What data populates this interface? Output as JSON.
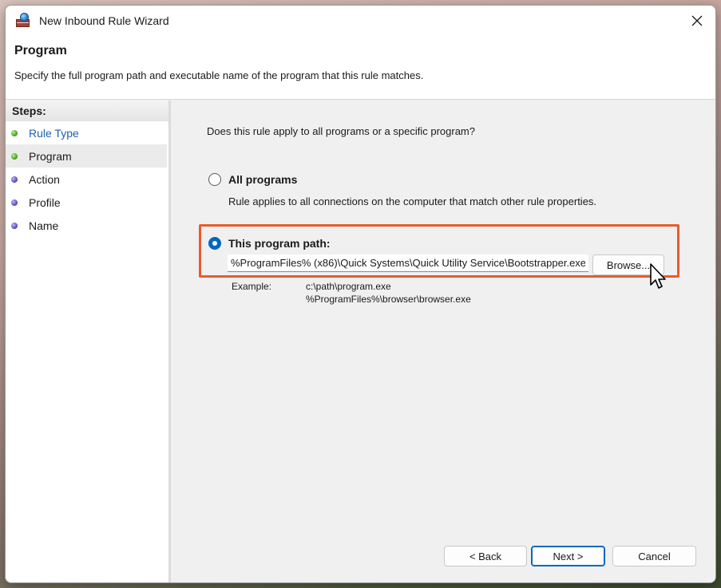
{
  "window": {
    "title": "New Inbound Rule Wizard",
    "close_icon": "close-icon",
    "app_icon": "firewall-icon"
  },
  "header": {
    "title": "Program",
    "subtitle": "Specify the full program path and executable name of the program that this rule matches."
  },
  "steps": {
    "title": "Steps:",
    "items": [
      {
        "label": "Rule Type",
        "state": "completed"
      },
      {
        "label": "Program",
        "state": "current"
      },
      {
        "label": "Action",
        "state": "pending"
      },
      {
        "label": "Profile",
        "state": "pending"
      },
      {
        "label": "Name",
        "state": "pending"
      }
    ]
  },
  "main": {
    "question": "Does this rule apply to all programs or a specific program?",
    "all_programs": {
      "label": "All programs",
      "description": "Rule applies to all connections on the computer that match other rule properties.",
      "checked": false
    },
    "program_path": {
      "label": "This program path:",
      "checked": true,
      "value": "%ProgramFiles% (x86)\\Quick Systems\\Quick Utility Service\\Bootstrapper.exe",
      "browse_label": "Browse..."
    },
    "example": {
      "label": "Example:",
      "line1": "c:\\path\\program.exe",
      "line2": "%ProgramFiles%\\browser\\browser.exe"
    }
  },
  "footer": {
    "back_label": "< Back",
    "next_label": "Next >",
    "cancel_label": "Cancel"
  },
  "colors": {
    "accent": "#0067c0",
    "highlight": "#e85c2c",
    "completed_dot": "#3c9b16",
    "pending_dot": "#4a43b8",
    "link": "#1f5fb0"
  }
}
